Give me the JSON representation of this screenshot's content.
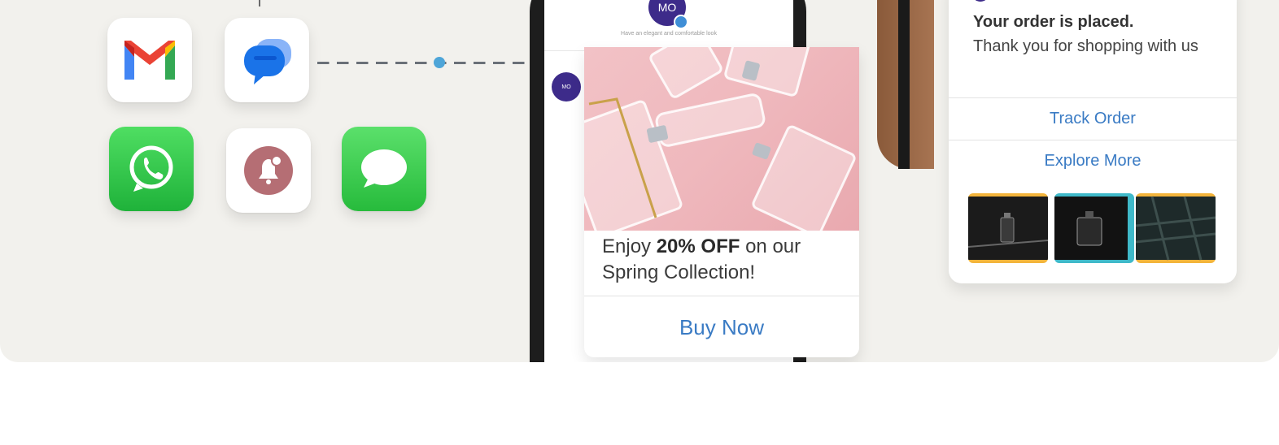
{
  "apps": [
    {
      "name": "Gmail",
      "icon": "gmail-icon"
    },
    {
      "name": "Google Messages",
      "icon": "google-messages-icon"
    },
    {
      "name": "WhatsApp",
      "icon": "whatsapp-icon"
    },
    {
      "name": "Push Notification",
      "icon": "notification-bell-icon"
    },
    {
      "name": "iMessage",
      "icon": "imessage-icon"
    }
  ],
  "chat": {
    "sender_initials": "MO",
    "subtitle": "Have an elegant and comfortable look",
    "small_avatar_initials": "MO"
  },
  "promo": {
    "text_before": "Enjoy ",
    "text_bold": "20% OFF",
    "text_after": " on our Spring Collection!",
    "cta": "Buy Now"
  },
  "order": {
    "title": "Your order is placed.",
    "body": "Thank you for shopping with us",
    "track_label": "Track Order",
    "explore_label": "Explore More"
  },
  "colors": {
    "accent_link": "#3a7bc4",
    "avatar": "#3d2b8a",
    "card_bg": "#f2f1ed"
  }
}
